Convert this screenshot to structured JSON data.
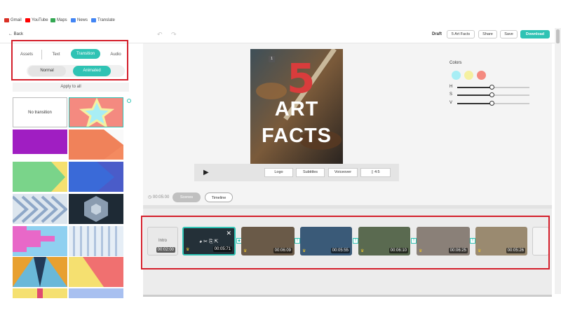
{
  "bookmarks": [
    {
      "label": "Gmail",
      "icon": "gmail-icon",
      "color": "#d93025"
    },
    {
      "label": "YouTube",
      "icon": "youtube-icon",
      "color": "#ff0000"
    },
    {
      "label": "Maps",
      "icon": "maps-icon",
      "color": "#34a853"
    },
    {
      "label": "News",
      "icon": "news-icon",
      "color": "#4285f4"
    },
    {
      "label": "Translate",
      "icon": "translate-icon",
      "color": "#4285f4"
    }
  ],
  "header": {
    "back_label": "Back",
    "draft_label": "Draft",
    "project_name": "5 Art Facts",
    "share_label": "Share",
    "save_label": "Save",
    "download_label": "Download"
  },
  "sidebar": {
    "tabs": [
      "Assets",
      "Text",
      "Transition",
      "Audio"
    ],
    "active_tab": "Transition",
    "modes": [
      "Normal",
      "Animated"
    ],
    "active_mode": "Animated",
    "apply_label": "Apply to all",
    "no_transition_label": "No transition"
  },
  "preview": {
    "badge": "1",
    "number": "5",
    "line1": "ART",
    "line2": "FACTS"
  },
  "controls": {
    "logo_label": "Logo",
    "subtitles_label": "Subtitles",
    "voiceover_label": "Voiceover",
    "ratio_label": "4:5"
  },
  "colors_panel": {
    "label": "Colors",
    "swatches": [
      "#a8eef5",
      "#f5f0a0",
      "#f48a80"
    ],
    "sliders": [
      {
        "label": "H",
        "value": 0.5
      },
      {
        "label": "S",
        "value": 0.5
      },
      {
        "label": "V",
        "value": 0.5
      }
    ]
  },
  "view": {
    "duration": "00:05:00",
    "scenes_label": "Scenes",
    "timeline_label": "Timeline"
  },
  "timeline": {
    "intro_label": "Intro",
    "intro_time": "00:02:00",
    "clips": [
      "00:05:71",
      "00:06:09",
      "00:05:55",
      "00:06:10",
      "00:06:25",
      "00:05:26"
    ]
  },
  "accent": "#2fc3b4"
}
